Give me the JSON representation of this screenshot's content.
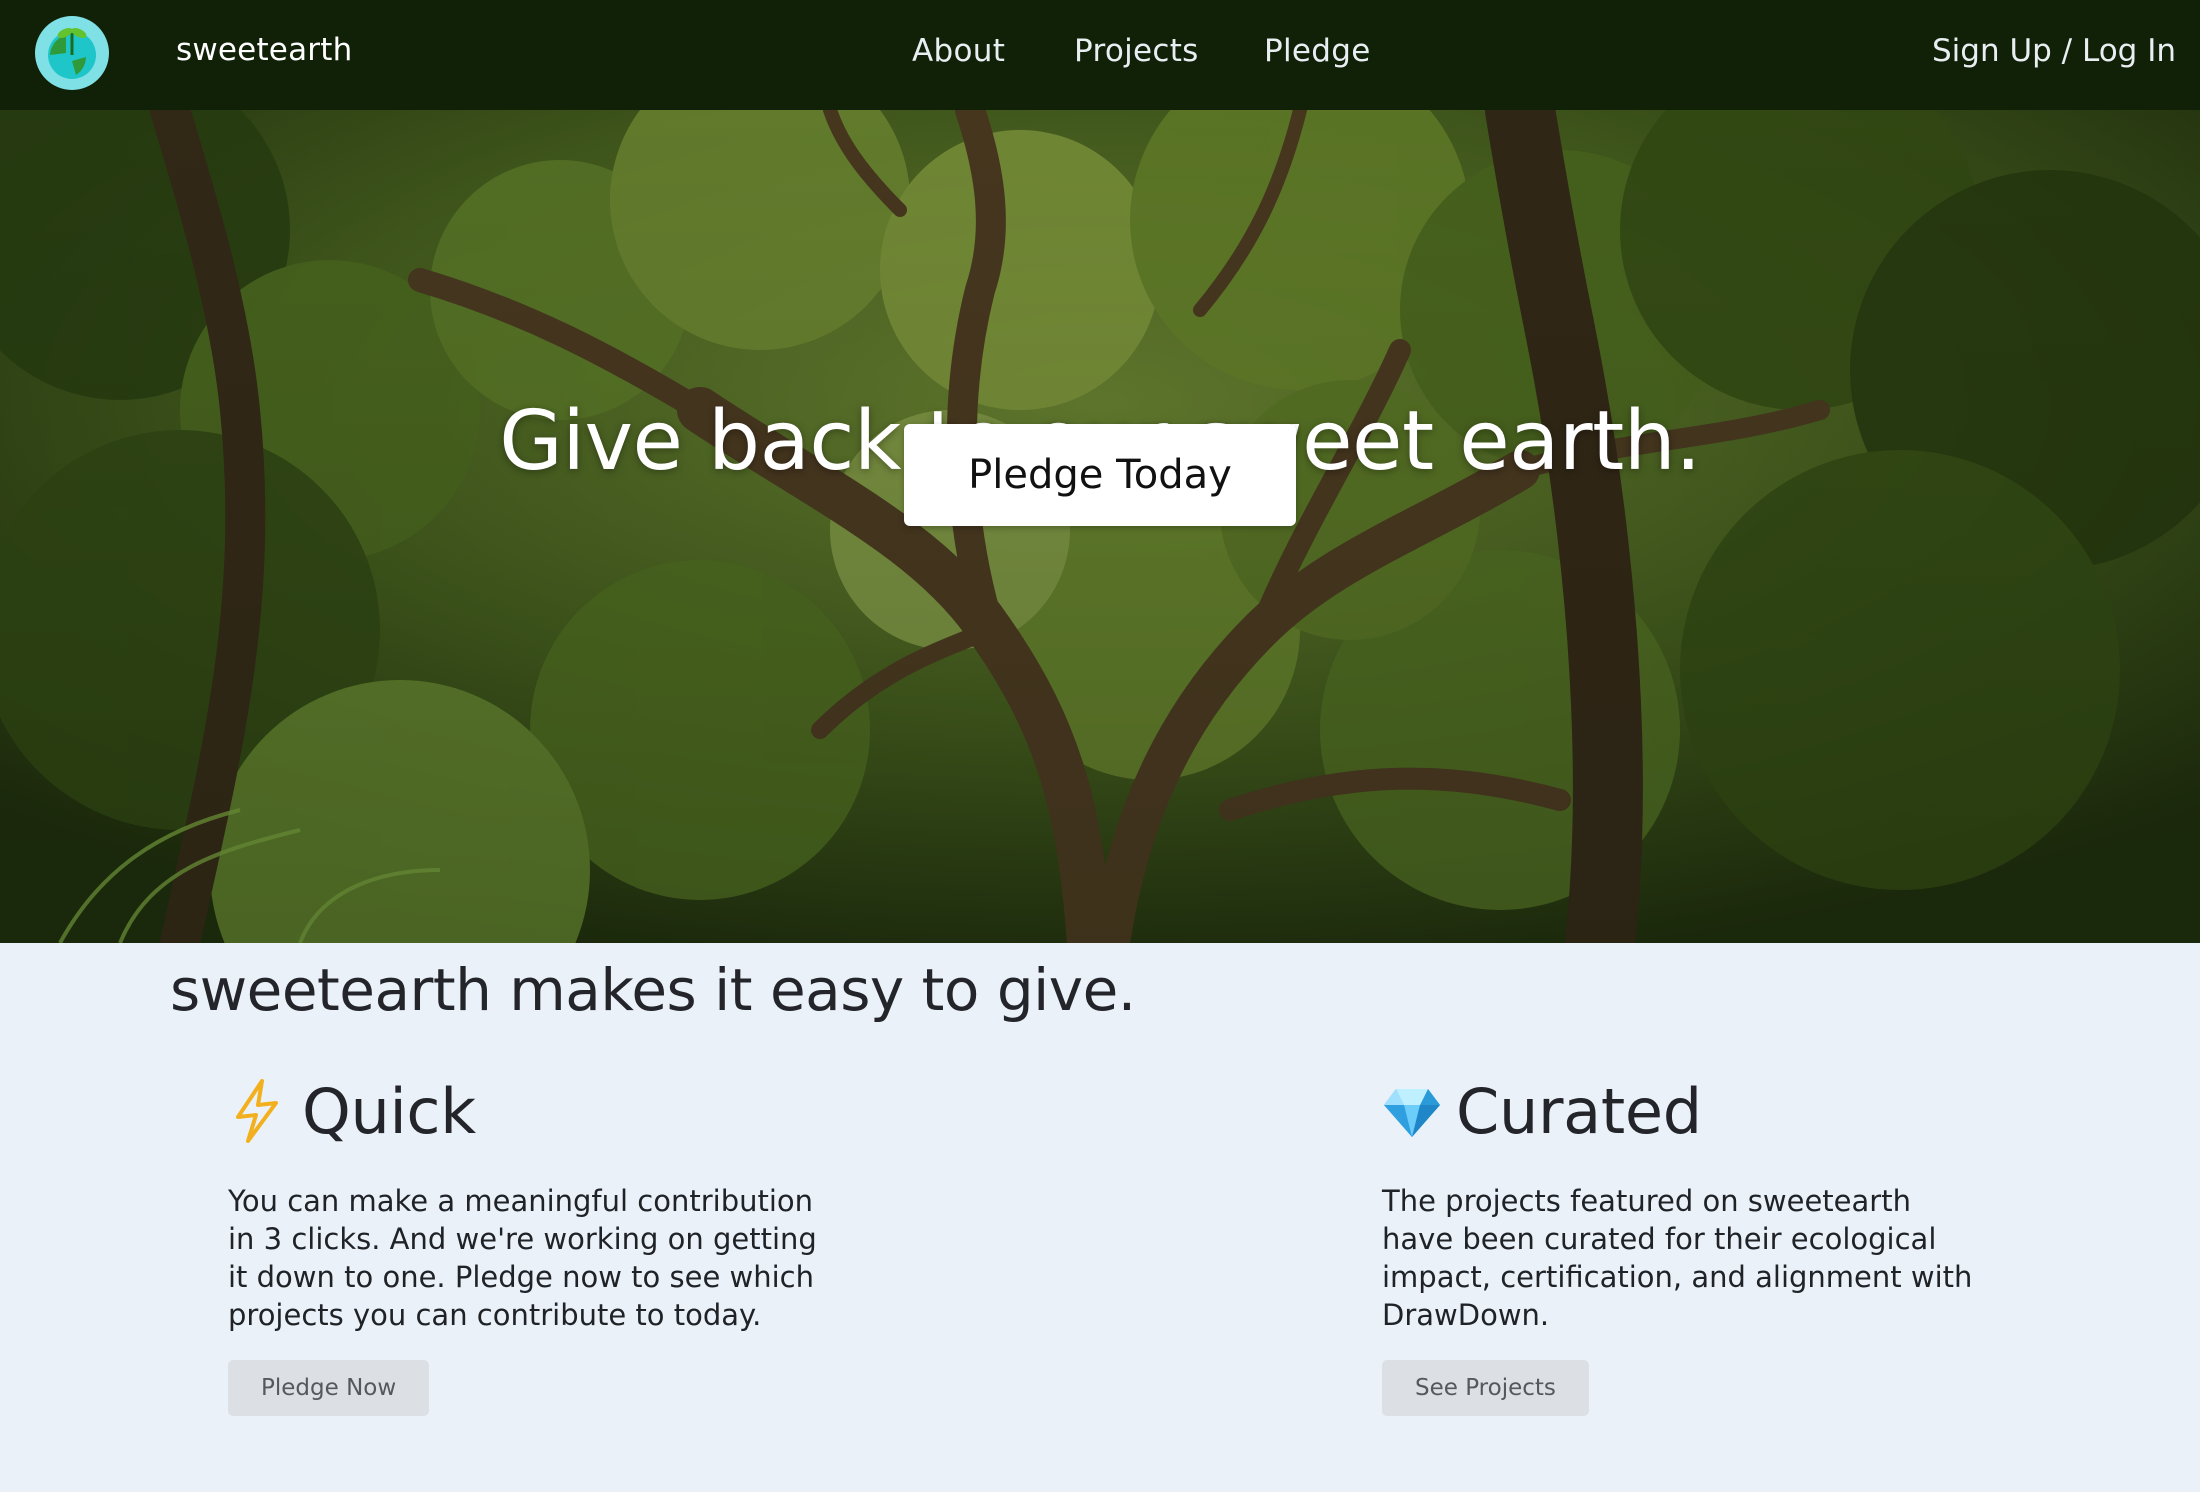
{
  "nav": {
    "brand": "sweetearth",
    "links": [
      {
        "label": "About"
      },
      {
        "label": "Projects"
      },
      {
        "label": "Pledge"
      }
    ],
    "auth": {
      "sign_up": "Sign Up",
      "separator": " / ",
      "log_in": "Log In"
    }
  },
  "hero": {
    "title": "Give back to our sweet earth.",
    "cta": "Pledge Today",
    "background": "forest-canopy-photo"
  },
  "main": {
    "tagline": "sweetearth makes it easy to give.",
    "features": [
      {
        "icon": "lightning-icon",
        "title": "Quick",
        "body": "You can make a meaningful contribution in 3 clicks. And we're working on getting it down to one. Pledge now to see which projects you can contribute to today.",
        "button": "Pledge Now"
      },
      {
        "icon": "gem-icon",
        "title": "Curated",
        "body": "The projects featured on sweetearth have been curated for their ecological impact, certification, and alignment with DrawDown.",
        "button": "See Projects"
      }
    ]
  },
  "colors": {
    "navbar": "#112108",
    "page_background": "#ebf1f9",
    "secondary_button": "#dcdfe3"
  }
}
